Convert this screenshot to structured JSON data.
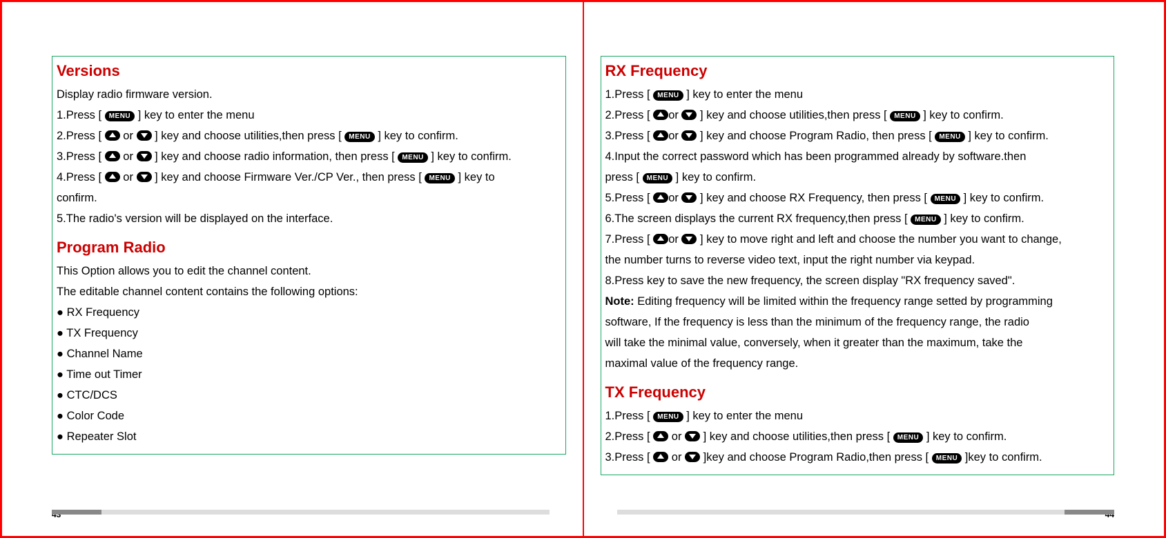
{
  "left": {
    "versions": {
      "title": "Versions",
      "intro": "Display radio firmware version.",
      "s1a": "1.Press [ ",
      "s1b": " ] key to enter the menu",
      "s2a": "2.Press [ ",
      "s2b": " or ",
      "s2c": " ] key and choose utilities,then press [ ",
      "s2d": " ] key to confirm.",
      "s3a": "3.Press [ ",
      "s3b": " or ",
      "s3c": " ] key and choose radio information, then press [ ",
      "s3d": " ] key to confirm.",
      "s4a": "4.Press [ ",
      "s4b": " or ",
      "s4c": " ] key and choose Firmware Ver./CP Ver., then press [ ",
      "s4d": " ] key to",
      "s4e": "confirm.",
      "s5": "5.The radio's version will be displayed on the interface."
    },
    "program": {
      "title": "Program Radio",
      "intro1": "This Option allows you to edit the channel content.",
      "intro2": "The editable channel content contains the following options:",
      "b1": "RX Frequency",
      "b2": "TX Frequency",
      "b3": "Channel Name",
      "b4": "Time out Timer",
      "b5": "CTC/DCS",
      "b6": "Color Code",
      "b7": "Repeater Slot"
    },
    "pagenum": "43"
  },
  "right": {
    "rx": {
      "title": "RX Frequency",
      "s1a": "1.Press [ ",
      "s1b": " ] key to enter the menu",
      "s2a": "2.Press [ ",
      "s2b": "or ",
      "s2c": " ] key and choose utilities,then press [ ",
      "s2d": " ] key to confirm.",
      "s3a": "3.Press [ ",
      "s3b": "or ",
      "s3c": " ] key and choose Program Radio, then press [ ",
      "s3d": " ] key to confirm.",
      "s4a": "4.Input the correct password which has been programmed already by software.then",
      "s4b": "press [ ",
      "s4c": " ] key to confirm.",
      "s5a": "5.Press [ ",
      "s5b": "or ",
      "s5c": " ] key and choose RX Frequency, then press [ ",
      "s5d": " ] key to confirm.",
      "s6a": "6.The screen displays the current RX frequency,then press [ ",
      "s6b": " ] key to confirm.",
      "s7a": "7.Press [ ",
      "s7b": "or ",
      "s7c": " ] key to move right and left and choose the number you want to change,",
      "s7d": "the number turns to reverse video text, input the right number via keypad.",
      "s8": "8.Press  key to save the new frequency, the screen display \"RX frequency saved\".",
      "note_label": "Note: ",
      "note1": "Editing frequency will be limited within the frequency range setted by programming",
      "note2": "software, If the frequency is less than the minimum of the frequency range, the radio",
      "note3": "will take the minimal value, conversely, when it greater than the maximum, take the",
      "note4": "maximal value of the frequency range."
    },
    "tx": {
      "title": "TX Frequency",
      "s1a": "1.Press [ ",
      "s1b": " ] key to enter the menu",
      "s2a": "2.Press [ ",
      "s2b": " or ",
      "s2c": " ] key and choose utilities,then press [ ",
      "s2d": " ] key to confirm.",
      "s3a": "3.Press [ ",
      "s3b": " or ",
      "s3c": "  ]key and choose Program Radio,then press [ ",
      "s3d": " ]key to confirm."
    },
    "pagenum": "44"
  },
  "menu_label": "MENU"
}
